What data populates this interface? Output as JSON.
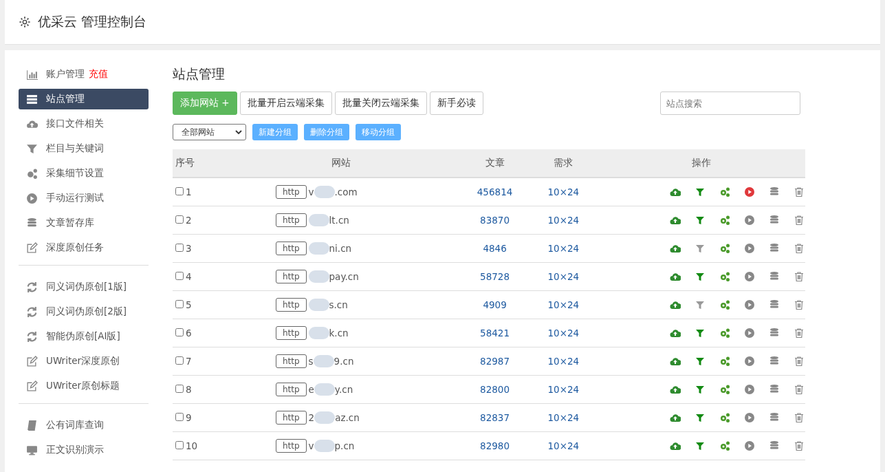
{
  "header": {
    "title": "优采云 管理控制台"
  },
  "sidebar": {
    "groups": [
      [
        {
          "kind": "chart",
          "label": "账户管理",
          "badge": "充值",
          "selected": false
        },
        {
          "kind": "server",
          "label": "站点管理",
          "selected": true
        },
        {
          "kind": "cloud",
          "label": "接口文件相关",
          "selected": false
        },
        {
          "kind": "filter",
          "label": "栏目与关键词",
          "selected": false
        },
        {
          "kind": "gears",
          "label": "采集细节设置",
          "selected": false
        },
        {
          "kind": "play",
          "label": "手动运行测试",
          "selected": false
        },
        {
          "kind": "database",
          "label": "文章暂存库",
          "selected": false
        },
        {
          "kind": "edit",
          "label": "深度原创任务",
          "selected": false
        }
      ],
      [
        {
          "kind": "refresh",
          "label": "同义词伪原创[1版]",
          "selected": false
        },
        {
          "kind": "refresh",
          "label": "同义词伪原创[2版]",
          "selected": false
        },
        {
          "kind": "refresh",
          "label": "智能伪原创[AI版]",
          "selected": false
        },
        {
          "kind": "edit",
          "label": "UWriter深度原创",
          "selected": false
        },
        {
          "kind": "edit",
          "label": "UWriter原创标题",
          "selected": false
        }
      ],
      [
        {
          "kind": "book",
          "label": "公有词库查询",
          "selected": false
        },
        {
          "kind": "monitor",
          "label": "正文识别演示",
          "selected": false
        }
      ]
    ]
  },
  "main": {
    "title": "站点管理",
    "buttons": [
      {
        "kind": "primary",
        "label": "添加网站 +"
      },
      {
        "kind": "default",
        "label": "批量开启云端采集"
      },
      {
        "kind": "default",
        "label": "批量关闭云端采集"
      },
      {
        "kind": "default",
        "label": "新手必读"
      }
    ],
    "search": {
      "placeholder": "站点搜索"
    },
    "group_select": {
      "value": "全部网站"
    },
    "group_buttons": [
      "新建分组",
      "删除分组",
      "移动分组"
    ],
    "table": {
      "columns": [
        "序号",
        "网站",
        "文章",
        "需求",
        "操作"
      ],
      "rows": [
        {
          "index": "1",
          "checked": false,
          "protocol": "http",
          "prefix": "v",
          "suffix": ".com",
          "articles": "456814",
          "demand": "10×24",
          "filter_on": true,
          "running": true
        },
        {
          "index": "2",
          "checked": false,
          "protocol": "http",
          "prefix": "",
          "suffix": "lt.cn",
          "articles": "83870",
          "demand": "10×24",
          "filter_on": true,
          "running": false
        },
        {
          "index": "3",
          "checked": false,
          "protocol": "http",
          "prefix": "",
          "suffix": "ni.cn",
          "articles": "4846",
          "demand": "10×24",
          "filter_on": false,
          "running": false
        },
        {
          "index": "4",
          "checked": false,
          "protocol": "http",
          "prefix": "",
          "suffix": "pay.cn",
          "articles": "58728",
          "demand": "10×24",
          "filter_on": true,
          "running": false
        },
        {
          "index": "5",
          "checked": false,
          "protocol": "http",
          "prefix": "",
          "suffix": "s.cn",
          "articles": "4909",
          "demand": "10×24",
          "filter_on": false,
          "running": false
        },
        {
          "index": "6",
          "checked": false,
          "protocol": "http",
          "prefix": "",
          "suffix": "k.cn",
          "articles": "58421",
          "demand": "10×24",
          "filter_on": true,
          "running": false
        },
        {
          "index": "7",
          "checked": false,
          "protocol": "http",
          "prefix": "s",
          "suffix": "9.cn",
          "articles": "82987",
          "demand": "10×24",
          "filter_on": true,
          "running": false
        },
        {
          "index": "8",
          "checked": false,
          "protocol": "http",
          "prefix": "e",
          "suffix": "y.cn",
          "articles": "82800",
          "demand": "10×24",
          "filter_on": true,
          "running": false
        },
        {
          "index": "9",
          "checked": false,
          "protocol": "http",
          "prefix": "2",
          "suffix": "az.cn",
          "articles": "82837",
          "demand": "10×24",
          "filter_on": true,
          "running": false
        },
        {
          "index": "10",
          "checked": false,
          "protocol": "http",
          "prefix": "v",
          "suffix": "p.cn",
          "articles": "82980",
          "demand": "10×24",
          "filter_on": true,
          "running": false
        }
      ]
    }
  }
}
